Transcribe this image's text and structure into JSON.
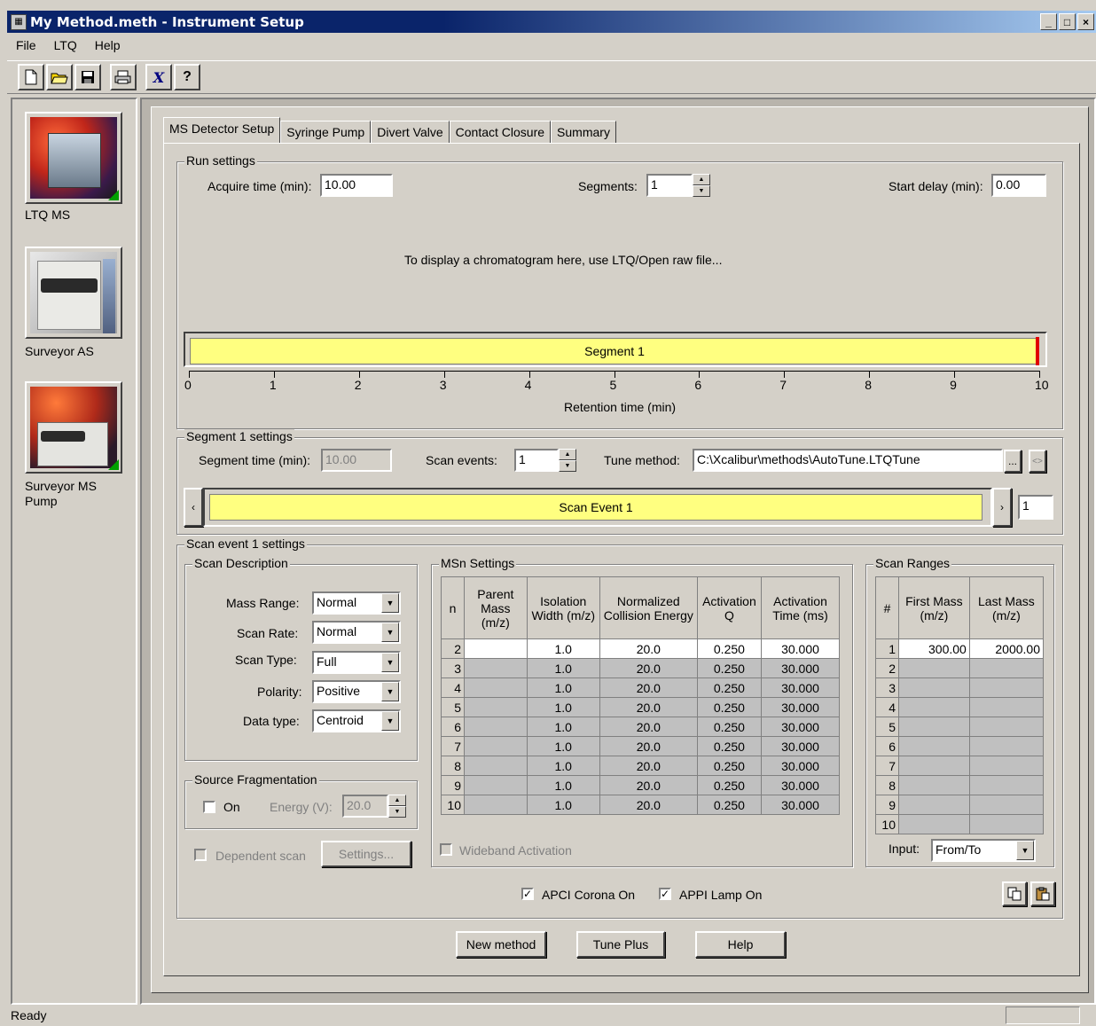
{
  "window": {
    "title": "My Method.meth - Instrument Setup",
    "min": "_",
    "max": "□",
    "close": "×"
  },
  "menu": {
    "file": "File",
    "ltq": "LTQ",
    "help": "Help"
  },
  "instruments": [
    {
      "label": "LTQ MS"
    },
    {
      "label": "Surveyor AS"
    },
    {
      "label": "Surveyor MS Pump"
    }
  ],
  "tabs": [
    "MS Detector Setup",
    "Syringe Pump",
    "Divert Valve",
    "Contact Closure",
    "Summary"
  ],
  "run_settings": {
    "title": "Run settings",
    "acquire_label": "Acquire time (min):",
    "acquire_value": "10.00",
    "segments_label": "Segments:",
    "segments_value": "1",
    "start_delay_label": "Start delay (min):",
    "start_delay_value": "0.00",
    "chromatogram_msg": "To display a chromatogram here, use LTQ/Open raw file...",
    "segment_bar_label": "Segment 1",
    "axis_ticks": [
      "0",
      "1",
      "2",
      "3",
      "4",
      "5",
      "6",
      "7",
      "8",
      "9",
      "10"
    ],
    "axis_label": "Retention time (min)"
  },
  "segment_settings": {
    "title": "Segment 1 settings",
    "segment_time_label": "Segment time (min):",
    "segment_time_value": "10.00",
    "scan_events_label": "Scan events:",
    "scan_events_value": "1",
    "tune_method_label": "Tune method:",
    "tune_method_value": "C:\\Xcalibur\\methods\\AutoTune.LTQTune",
    "browse_label": "...",
    "scan_event_bar_label": "Scan Event 1",
    "scan_event_index": "1"
  },
  "scan_event": {
    "title": "Scan event 1 settings",
    "description_title": "Scan Description",
    "mass_range_label": "Mass Range:",
    "mass_range_value": "Normal",
    "scan_rate_label": "Scan Rate:",
    "scan_rate_value": "Normal",
    "scan_type_label": "Scan Type:",
    "scan_type_value": "Full",
    "polarity_label": "Polarity:",
    "polarity_value": "Positive",
    "data_type_label": "Data type:",
    "data_type_value": "Centroid",
    "source_frag_title": "Source Fragmentation",
    "on_label": "On",
    "energy_label": "Energy (V):",
    "energy_value": "20.0",
    "dependent_scan_label": "Dependent scan",
    "settings_label": "Settings..."
  },
  "msn": {
    "title": "MSn Settings",
    "headers": [
      "n",
      "Parent Mass (m/z)",
      "Isolation Width (m/z)",
      "Normalized Collision Energy",
      "Activation Q",
      "Activation Time (ms)"
    ],
    "rows": [
      [
        "2",
        "",
        "1.0",
        "20.0",
        "0.250",
        "30.000"
      ],
      [
        "3",
        "",
        "1.0",
        "20.0",
        "0.250",
        "30.000"
      ],
      [
        "4",
        "",
        "1.0",
        "20.0",
        "0.250",
        "30.000"
      ],
      [
        "5",
        "",
        "1.0",
        "20.0",
        "0.250",
        "30.000"
      ],
      [
        "6",
        "",
        "1.0",
        "20.0",
        "0.250",
        "30.000"
      ],
      [
        "7",
        "",
        "1.0",
        "20.0",
        "0.250",
        "30.000"
      ],
      [
        "8",
        "",
        "1.0",
        "20.0",
        "0.250",
        "30.000"
      ],
      [
        "9",
        "",
        "1.0",
        "20.0",
        "0.250",
        "30.000"
      ],
      [
        "10",
        "",
        "1.0",
        "20.0",
        "0.250",
        "30.000"
      ]
    ],
    "wideband_label": "Wideband Activation"
  },
  "scan_ranges": {
    "title": "Scan Ranges",
    "headers": [
      "#",
      "First Mass (m/z)",
      "Last Mass (m/z)"
    ],
    "rows": [
      [
        "1",
        "300.00",
        "2000.00"
      ],
      [
        "2",
        "",
        ""
      ],
      [
        "3",
        "",
        ""
      ],
      [
        "4",
        "",
        ""
      ],
      [
        "5",
        "",
        ""
      ],
      [
        "6",
        "",
        ""
      ],
      [
        "7",
        "",
        ""
      ],
      [
        "8",
        "",
        ""
      ],
      [
        "9",
        "",
        ""
      ],
      [
        "10",
        "",
        ""
      ]
    ],
    "input_label": "Input:",
    "input_value": "From/To"
  },
  "options": {
    "apci_label": "APCI Corona On",
    "appi_label": "APPI Lamp On"
  },
  "buttons": {
    "new_method": "New method",
    "tune_plus": "Tune Plus",
    "help": "Help"
  },
  "status": {
    "text": "Ready"
  }
}
